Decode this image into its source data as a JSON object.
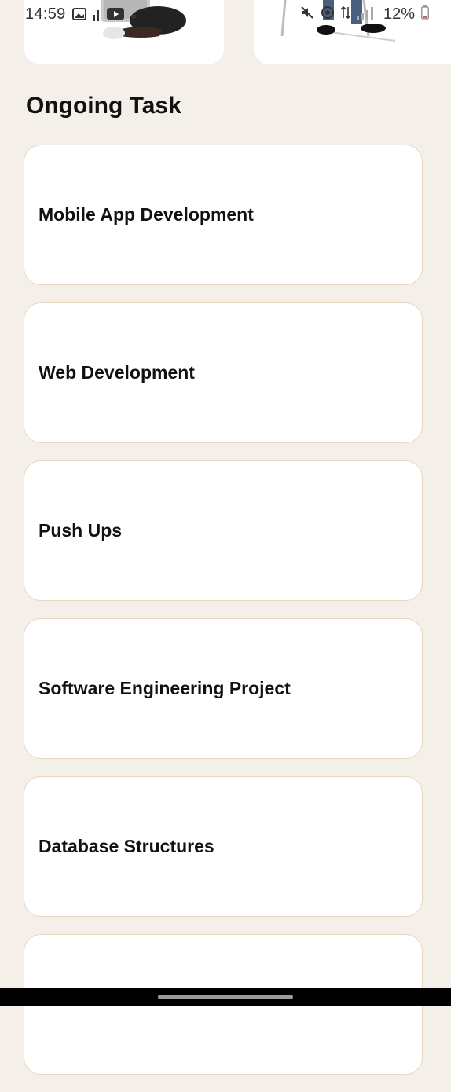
{
  "status_bar": {
    "time": "14:59",
    "battery": "12%"
  },
  "section": {
    "title": "Ongoing Task"
  },
  "tasks": [
    {
      "title": "Mobile App Development"
    },
    {
      "title": "Web Development"
    },
    {
      "title": "Push Ups"
    },
    {
      "title": "Software Engineering Project"
    },
    {
      "title": "Database Structures"
    },
    {
      "title": ""
    }
  ],
  "colors": {
    "background": "#f5efe9",
    "card": "#ffffff",
    "card_border": "#e8d6c2",
    "text": "#111111"
  }
}
